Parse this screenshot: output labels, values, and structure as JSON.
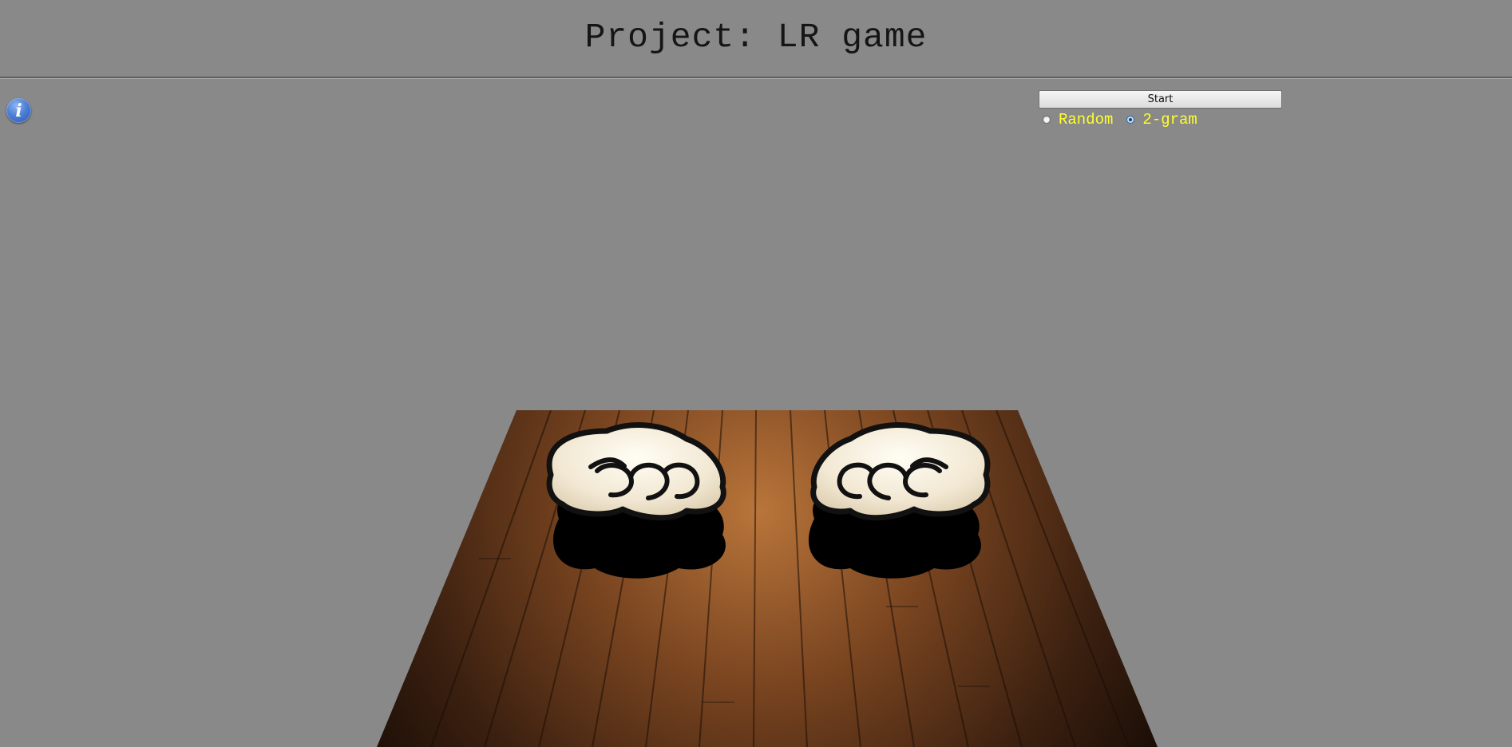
{
  "header": {
    "title": "Project: LR game"
  },
  "toolbar": {
    "start_label": "Start"
  },
  "modes": [
    {
      "label": "Random",
      "checked": false
    },
    {
      "label": "2-gram",
      "checked": true
    }
  ],
  "icons": {
    "info": "info-icon",
    "left_fist": "left-fist-icon",
    "right_fist": "right-fist-icon"
  },
  "colors": {
    "background": "#898989",
    "label_yellow": "#ffff2e",
    "info_blue": "#4d7fd6"
  }
}
